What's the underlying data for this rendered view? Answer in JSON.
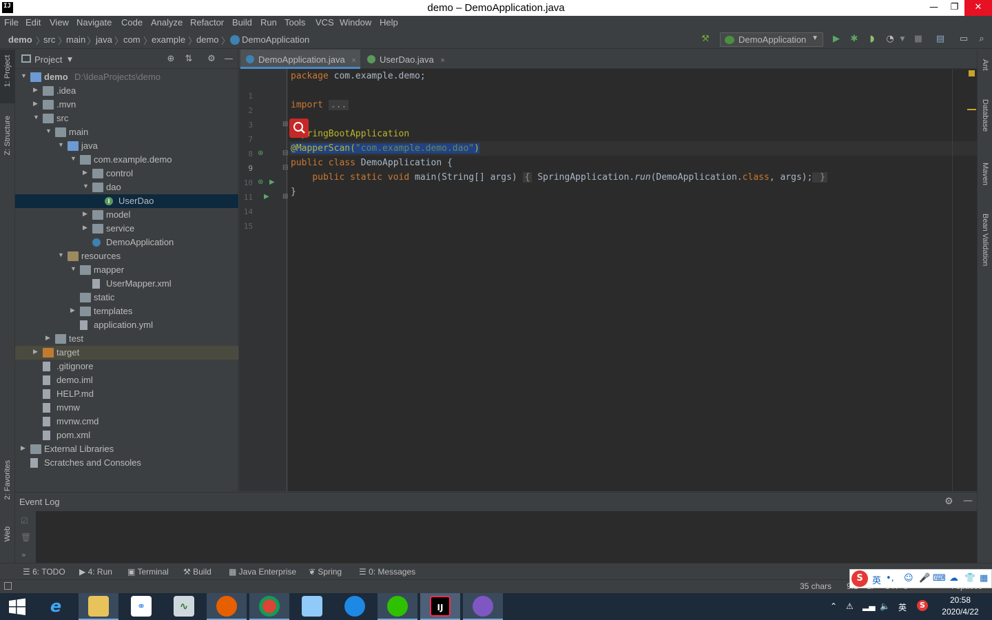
{
  "window": {
    "title": "demo – DemoApplication.java",
    "app_icon": "IJ",
    "minimize": "—",
    "restore": "❐",
    "close": "✕"
  },
  "menu": [
    "File",
    "Edit",
    "View",
    "Navigate",
    "Code",
    "Analyze",
    "Refactor",
    "Build",
    "Run",
    "Tools",
    "VCS",
    "Window",
    "Help"
  ],
  "breadcrumb": [
    "demo",
    "src",
    "main",
    "java",
    "com",
    "example",
    "demo",
    "DemoApplication"
  ],
  "run_config": "DemoApplication",
  "left_stripe": [
    "1: Project",
    "Z: Structure",
    "2: Favorites",
    "Web"
  ],
  "right_stripe": [
    "Ant",
    "Database",
    "Maven",
    "Bean Validation"
  ],
  "project_panel": {
    "title": "Project",
    "tree": [
      {
        "label": "demo",
        "hint": "D:\\IdeaProjects\\demo",
        "depth": 0,
        "expanded": true,
        "icon": "module-folder"
      },
      {
        "label": ".idea",
        "depth": 1,
        "expanded": false,
        "icon": "folder"
      },
      {
        "label": ".mvn",
        "depth": 1,
        "expanded": false,
        "icon": "folder"
      },
      {
        "label": "src",
        "depth": 1,
        "expanded": true,
        "icon": "folder"
      },
      {
        "label": "main",
        "depth": 2,
        "expanded": true,
        "icon": "folder"
      },
      {
        "label": "java",
        "depth": 3,
        "expanded": true,
        "icon": "source-folder"
      },
      {
        "label": "com.example.demo",
        "depth": 4,
        "expanded": true,
        "icon": "package"
      },
      {
        "label": "control",
        "depth": 5,
        "expanded": false,
        "icon": "package"
      },
      {
        "label": "dao",
        "depth": 5,
        "expanded": true,
        "icon": "package"
      },
      {
        "label": "UserDao",
        "depth": 6,
        "icon": "interface",
        "selected": true
      },
      {
        "label": "model",
        "depth": 5,
        "expanded": false,
        "icon": "package"
      },
      {
        "label": "service",
        "depth": 5,
        "expanded": false,
        "icon": "package"
      },
      {
        "label": "DemoApplication",
        "depth": 5,
        "icon": "spring-class"
      },
      {
        "label": "resources",
        "depth": 3,
        "expanded": true,
        "icon": "resources-folder"
      },
      {
        "label": "mapper",
        "depth": 4,
        "expanded": true,
        "icon": "folder"
      },
      {
        "label": "UserMapper.xml",
        "depth": 5,
        "icon": "xml-file"
      },
      {
        "label": "static",
        "depth": 4,
        "icon": "folder"
      },
      {
        "label": "templates",
        "depth": 4,
        "expanded": false,
        "icon": "folder"
      },
      {
        "label": "application.yml",
        "depth": 4,
        "icon": "yml-file"
      },
      {
        "label": "test",
        "depth": 2,
        "expanded": false,
        "icon": "folder"
      },
      {
        "label": "target",
        "depth": 1,
        "expanded": false,
        "icon": "excluded-folder",
        "highlight": true
      },
      {
        "label": ".gitignore",
        "depth": 1,
        "icon": "text-file"
      },
      {
        "label": "demo.iml",
        "depth": 1,
        "icon": "text-file"
      },
      {
        "label": "HELP.md",
        "depth": 1,
        "icon": "markdown-file"
      },
      {
        "label": "mvnw",
        "depth": 1,
        "icon": "script-file"
      },
      {
        "label": "mvnw.cmd",
        "depth": 1,
        "icon": "text-file"
      },
      {
        "label": "pom.xml",
        "depth": 1,
        "icon": "maven-file"
      },
      {
        "label": "External Libraries",
        "depth": 0,
        "expanded": false,
        "icon": "libraries"
      },
      {
        "label": "Scratches and Consoles",
        "depth": 0,
        "icon": "scratches"
      }
    ]
  },
  "editor": {
    "tabs": [
      {
        "label": "DemoApplication.java",
        "active": true
      },
      {
        "label": "UserDao.java",
        "active": false
      }
    ],
    "close_glyph": "×",
    "lines": [
      {
        "n": "1",
        "parts": [
          [
            "kw",
            "package "
          ],
          [
            "",
            "com.example.demo;"
          ]
        ]
      },
      {
        "n": "2",
        "parts": []
      },
      {
        "n": "3",
        "parts": [
          [
            "kw",
            "import "
          ],
          [
            "fold",
            "..."
          ]
        ]
      },
      {
        "n": "7",
        "parts": []
      },
      {
        "n": "8",
        "parts": [
          [
            "ann",
            "@SpringBootApplication"
          ]
        ]
      },
      {
        "n": "9",
        "parts": [
          [
            "ann sel",
            "@MapperScan("
          ],
          [
            "str sel",
            "\"com.example.demo.dao\""
          ],
          [
            "ann sel",
            ")"
          ]
        ]
      },
      {
        "n": "10",
        "parts": [
          [
            "kw",
            "public class "
          ],
          [
            "",
            "DemoApplication {"
          ]
        ]
      },
      {
        "n": "11",
        "parts": [
          [
            "",
            "    "
          ],
          [
            "kw",
            "public static void "
          ],
          [
            "",
            "main(String[] args) "
          ],
          [
            "fold",
            "{"
          ],
          [
            "",
            " SpringApplication."
          ],
          [
            "it",
            "run"
          ],
          [
            "",
            "(DemoApplication."
          ],
          [
            "kw",
            "class"
          ],
          [
            "",
            ", args);"
          ],
          [
            "fold",
            " }"
          ]
        ]
      },
      {
        "n": "14",
        "parts": [
          [
            "",
            "}"
          ]
        ]
      },
      {
        "n": "15",
        "parts": []
      }
    ]
  },
  "event_log": {
    "title": "Event Log"
  },
  "bottom_tools": [
    "6: TODO",
    "4: Run",
    "Terminal",
    "Build",
    "Java Enterprise",
    "Spring",
    "0: Messages"
  ],
  "status": {
    "chars": "35 chars",
    "position": "9:1",
    "line_sep": "LF",
    "encoding": "UTF-8",
    "indent": "4 spaces"
  },
  "ime": {
    "lang": "英",
    "punct": "•,"
  },
  "taskbar": {
    "apps": [
      "start",
      "ie",
      "explorer",
      "baidu-netdisk",
      "task-manager",
      "firefox",
      "chrome",
      "notepad",
      "qq-browser",
      "wechat",
      "intellij",
      "dbeaver"
    ],
    "tray_lang": "英",
    "time": "20:58",
    "date": "2020/4/22"
  }
}
